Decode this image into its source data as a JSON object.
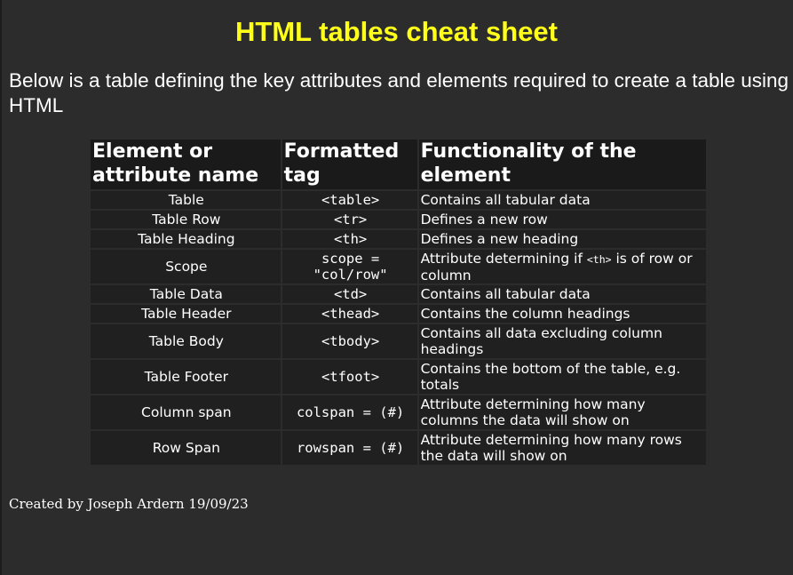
{
  "page": {
    "title": "HTML tables cheat sheet",
    "intro": "Below is a table defining the key attributes and elements required to create a table using HTML",
    "credit": "Created by Joseph Ardern 19/09/23",
    "title_color": "#ffff1a",
    "background_color": "#2c2c2c"
  },
  "table": {
    "headers": [
      "Element or attribute name",
      "Formatted tag",
      "Functionality of the element"
    ],
    "rows": [
      {
        "name": "Table",
        "tag": "<table>",
        "desc": "Contains all tabular data"
      },
      {
        "name": "Table Row",
        "tag": "<tr>",
        "desc": "Defines a new row"
      },
      {
        "name": "Table Heading",
        "tag": "<th>",
        "desc": "Defines a new heading"
      },
      {
        "name": "Scope",
        "tag": "scope = \"col/row\"",
        "desc_before": "Attribute determining if ",
        "desc_code": "<th>",
        "desc_after": " is of row or column"
      },
      {
        "name": "Table Data",
        "tag": "<td>",
        "desc": "Contains all tabular data"
      },
      {
        "name": "Table Header",
        "tag": "<thead>",
        "desc": "Contains the column headings"
      },
      {
        "name": "Table Body",
        "tag": "<tbody>",
        "desc": "Contains all data excluding column headings"
      },
      {
        "name": "Table Footer",
        "tag": "<tfoot>",
        "desc": "Contains the bottom of the table, e.g. totals"
      },
      {
        "name": "Column span",
        "tag": "colspan = (#)",
        "desc": "Attribute determining how many columns the data will show on"
      },
      {
        "name": "Row Span",
        "tag": "rowspan = (#)",
        "desc": "Attribute determining how many rows the data will show on"
      }
    ]
  }
}
